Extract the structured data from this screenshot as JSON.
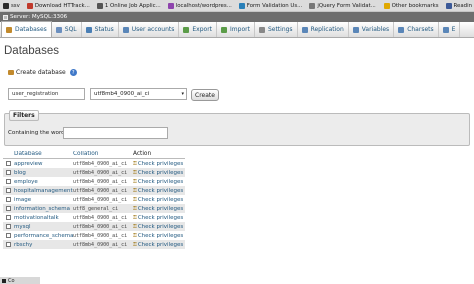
{
  "bookmarks": {
    "items": [
      {
        "label": "ssv",
        "color": "#2a2a2a"
      },
      {
        "label": "Download HTTrack...",
        "color": "#c0392b"
      },
      {
        "label": "1 Online Job Applic...",
        "color": "#555555"
      },
      {
        "label": "localhost/wordpres...",
        "color": "#8e44ad"
      },
      {
        "label": "Form Validation Us...",
        "color": "#2980b9"
      },
      {
        "label": "jQuery Form Validat...",
        "color": "#777777"
      }
    ],
    "right_items": [
      {
        "label": "Other bookmarks",
        "color": "#e0a800"
      },
      {
        "label": "Readin",
        "color": "#3b5998"
      }
    ]
  },
  "breadcrumb": {
    "label": "Server: MySQL:3306"
  },
  "tabs": [
    {
      "label": "Databases",
      "icon": "database-icon",
      "color": "#c28a2d",
      "active": true
    },
    {
      "label": "SQL",
      "icon": "sql-icon",
      "color": "#6b8fbf",
      "active": false
    },
    {
      "label": "Status",
      "icon": "status-icon",
      "color": "#4a7fb5",
      "active": false
    },
    {
      "label": "User accounts",
      "icon": "users-icon",
      "color": "#5a86b8",
      "active": false
    },
    {
      "label": "Export",
      "icon": "export-icon",
      "color": "#5b9c48",
      "active": false
    },
    {
      "label": "Import",
      "icon": "import-icon",
      "color": "#5b9c48",
      "active": false
    },
    {
      "label": "Settings",
      "icon": "wrench-icon",
      "color": "#888888",
      "active": false
    },
    {
      "label": "Replication",
      "icon": "replication-icon",
      "color": "#5a86b8",
      "active": false
    },
    {
      "label": "Variables",
      "icon": "variables-icon",
      "color": "#5a86b8",
      "active": false
    },
    {
      "label": "Charsets",
      "icon": "charsets-icon",
      "color": "#5a86b8",
      "active": false
    },
    {
      "label": "E",
      "icon": "engines-icon",
      "color": "#5a86b8",
      "active": false
    }
  ],
  "page": {
    "title": "Databases"
  },
  "create": {
    "label": "Create database",
    "db_name_value": "user_registration",
    "collation_value": "utf8mb4_0900_ai_ci",
    "button_label": "Create"
  },
  "filters": {
    "legend": "Filters",
    "contains_label": "Containing the word:",
    "contains_value": ""
  },
  "table": {
    "headers": {
      "database": "Database",
      "collation": "Collation",
      "action": "Action"
    },
    "rows": [
      {
        "database": "appreview",
        "collation": "utf8mb4_0900_ai_ci",
        "action": "Check privileges"
      },
      {
        "database": "blog",
        "collation": "utf8mb4_0900_ai_ci",
        "action": "Check privileges"
      },
      {
        "database": "employe",
        "collation": "utf8mb4_0900_ai_ci",
        "action": "Check privileges"
      },
      {
        "database": "hospitalmanagement",
        "collation": "utf8mb4_0900_ai_ci",
        "action": "Check privileges"
      },
      {
        "database": "image",
        "collation": "utf8mb4_0900_ai_ci",
        "action": "Check privileges"
      },
      {
        "database": "information_schema",
        "collation": "utf8_general_ci",
        "action": "Check privileges"
      },
      {
        "database": "motivationaltalk",
        "collation": "utf8mb4_0900_ai_ci",
        "action": "Check privileges"
      },
      {
        "database": "mysql",
        "collation": "utf8mb4_0900_ai_ci",
        "action": "Check privileges"
      },
      {
        "database": "performance_schema",
        "collation": "utf8mb4_0900_ai_ci",
        "action": "Check privileges"
      },
      {
        "database": "rbschy",
        "collation": "utf8mb4_0900_ai_ci",
        "action": "Check privileges"
      }
    ]
  },
  "console": {
    "label": "Co"
  }
}
